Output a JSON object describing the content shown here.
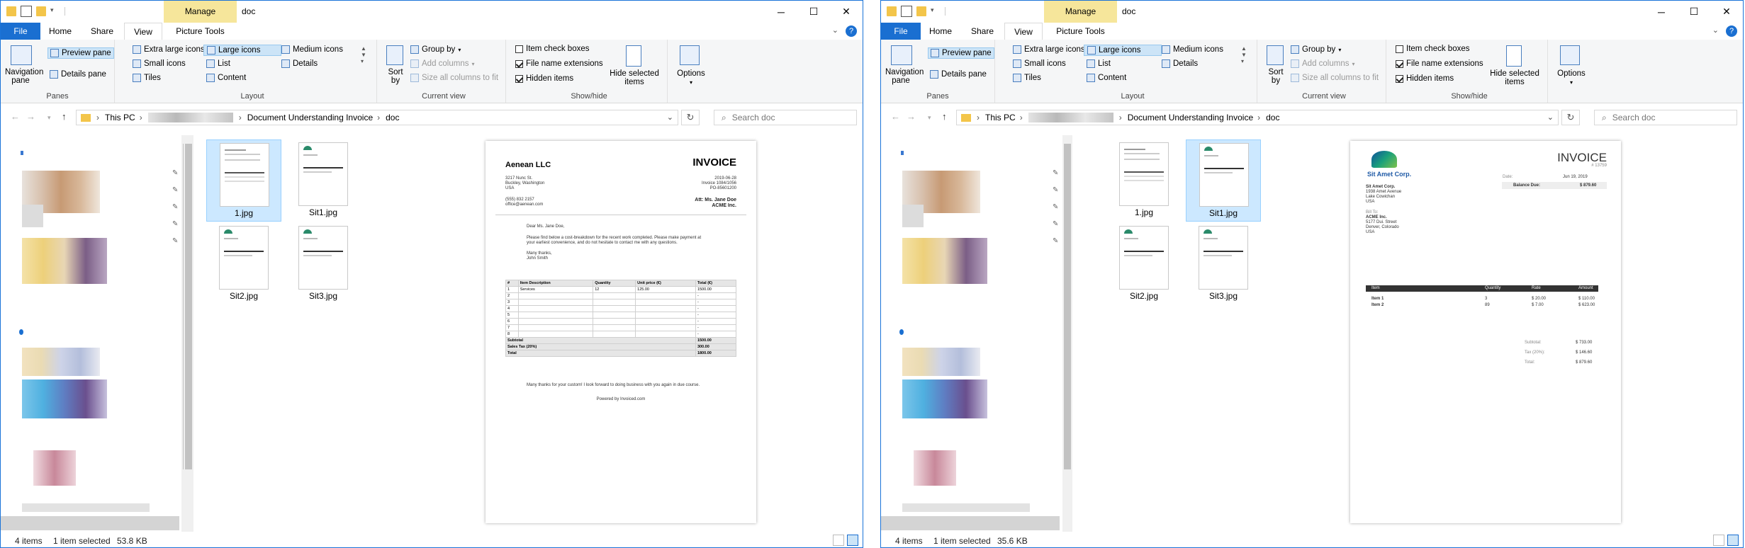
{
  "windows": [
    {
      "title": "doc",
      "manage_tab": "Manage",
      "tabs": [
        "File",
        "Home",
        "Share",
        "View",
        "Picture Tools"
      ],
      "ribbon": {
        "panes": {
          "navigation_pane": "Navigation pane",
          "preview_pane": "Preview pane",
          "details_pane": "Details pane",
          "label": "Panes"
        },
        "layout": {
          "items": [
            "Extra large icons",
            "Large icons",
            "Medium icons",
            "Small icons",
            "List",
            "Details",
            "Tiles",
            "Content"
          ],
          "selected": "Large icons",
          "label": "Layout"
        },
        "current_view": {
          "sort_by": "Sort by",
          "group_by": "Group by",
          "add_columns": "Add columns",
          "size_columns": "Size all columns to fit",
          "label": "Current view"
        },
        "show_hide": {
          "item_check_boxes": "Item check boxes",
          "file_name_extensions": "File name extensions",
          "hidden_items": "Hidden items",
          "hide_selected": "Hide selected items",
          "label": "Show/hide",
          "checks": {
            "item_check_boxes": false,
            "file_name_extensions": true,
            "hidden_items": true
          }
        },
        "options": "Options"
      },
      "address": {
        "root": "This PC",
        "folder": "Document Understanding Invoice",
        "current": "doc"
      },
      "search_placeholder": "Search doc",
      "files": [
        {
          "name": "1.jpg",
          "selected": true
        },
        {
          "name": "Sit1.jpg",
          "selected": false
        },
        {
          "name": "Sit2.jpg",
          "selected": false
        },
        {
          "name": "Sit3.jpg",
          "selected": false
        }
      ],
      "preview": {
        "company": "Aenean LLC",
        "title": "INVOICE",
        "from_address": [
          "3217 Nunc St.",
          "Buckley, Washington",
          "USA"
        ],
        "contact": [
          "(555) 832 2157",
          "office@aenean.com"
        ],
        "meta": [
          "2019-06-28",
          "Invoice 1084/1056",
          "PO-85601200"
        ],
        "attn": "Att: Ms. Jane Doe",
        "attn_company": "ACME Inc.",
        "greeting": "Dear Ms. Jane Doe,",
        "body_1": "Please find below a cost-breakdown for the recent work completed. Please make payment at",
        "body_2": "your earliest convenience, and do not hesitate to contact me with any questions.",
        "signoff": "Many thanks,",
        "signer": "John Smith",
        "table_headers": [
          "#",
          "Item Description",
          "Quantity",
          "Unit price (€)",
          "Total (€)"
        ],
        "table_rows": [
          [
            "1",
            "Services",
            "12",
            "125.00",
            "1500.00"
          ],
          [
            "2",
            "",
            "",
            "",
            "-"
          ],
          [
            "3",
            "",
            "",
            "",
            "-"
          ],
          [
            "4",
            "",
            "",
            "",
            "-"
          ],
          [
            "5",
            "",
            "",
            "",
            "-"
          ],
          [
            "6",
            "",
            "",
            "",
            "-"
          ],
          [
            "7",
            "",
            "",
            "",
            "-"
          ],
          [
            "8",
            "",
            "",
            "",
            "-"
          ]
        ],
        "subtotal_label": "Subtotal",
        "subtotal": "1500.00",
        "tax_label": "Sales Tax (20%)",
        "tax": "300.00",
        "total_label": "Total",
        "total": "1800.00",
        "thanks": "Many thanks for your custom! I look forward to doing business with you again in due course.",
        "powered": "Powered by Invoiced.com"
      },
      "status": {
        "count": "4 items",
        "selected": "1 item selected",
        "size": "53.8 KB"
      }
    },
    {
      "title": "doc",
      "manage_tab": "Manage",
      "tabs": [
        "File",
        "Home",
        "Share",
        "View",
        "Picture Tools"
      ],
      "ribbon": {
        "panes": {
          "navigation_pane": "Navigation pane",
          "preview_pane": "Preview pane",
          "details_pane": "Details pane",
          "label": "Panes"
        },
        "layout": {
          "items": [
            "Extra large icons",
            "Large icons",
            "Medium icons",
            "Small icons",
            "List",
            "Details",
            "Tiles",
            "Content"
          ],
          "selected": "Large icons",
          "label": "Layout"
        },
        "current_view": {
          "sort_by": "Sort by",
          "group_by": "Group by",
          "add_columns": "Add columns",
          "size_columns": "Size all columns to fit",
          "label": "Current view"
        },
        "show_hide": {
          "item_check_boxes": "Item check boxes",
          "file_name_extensions": "File name extensions",
          "hidden_items": "Hidden items",
          "hide_selected": "Hide selected items",
          "label": "Show/hide",
          "checks": {
            "item_check_boxes": false,
            "file_name_extensions": true,
            "hidden_items": true
          }
        },
        "options": "Options"
      },
      "address": {
        "root": "This PC",
        "folder": "Document Understanding Invoice",
        "current": "doc"
      },
      "search_placeholder": "Search doc",
      "files": [
        {
          "name": "1.jpg",
          "selected": false
        },
        {
          "name": "Sit1.jpg",
          "selected": true
        },
        {
          "name": "Sit2.jpg",
          "selected": false
        },
        {
          "name": "Sit3.jpg",
          "selected": false
        }
      ],
      "preview": {
        "company": "Sit Amet Corp.",
        "title": "INVOICE",
        "number": "# 13759",
        "from_address": [
          "Sit Amet Corp.",
          "1938 Amet Avenue",
          "Lake Cowichan",
          "USA"
        ],
        "bill_to_label": "Bill To:",
        "bill_to": [
          "ACME Inc.",
          "5177 Dui. Street",
          "Denver, Colorado",
          "USA"
        ],
        "date_label": "Date:",
        "date": "Jun 19, 2019",
        "balance_label": "Balance Due:",
        "balance": "$ 879.60",
        "table_headers": [
          "Item",
          "Quantity",
          "Rate",
          "Amount"
        ],
        "table_rows": [
          [
            "Item 1",
            "3",
            "$ 20.00",
            "$ 110.00"
          ],
          [
            "Item 2",
            "89",
            "$ 7.00",
            "$ 623.00"
          ]
        ],
        "subtotal_label": "Subtotal:",
        "subtotal": "$ 733.00",
        "tax_label": "Tax (20%):",
        "tax": "$ 146.60",
        "total_label": "Total:",
        "total": "$ 879.60"
      },
      "status": {
        "count": "4 items",
        "selected": "1 item selected",
        "size": "35.6 KB"
      }
    }
  ],
  "icons": [
    "folder-icon",
    "check-icon",
    "minimize-icon",
    "maximize-icon",
    "close-icon",
    "help-icon",
    "back-icon",
    "forward-icon",
    "up-icon",
    "refresh-icon",
    "search-icon",
    "pin-icon"
  ],
  "colors": {
    "accent": "#1a6fd1",
    "manage_tab": "#f6e69b",
    "selection": "#cce8ff"
  }
}
